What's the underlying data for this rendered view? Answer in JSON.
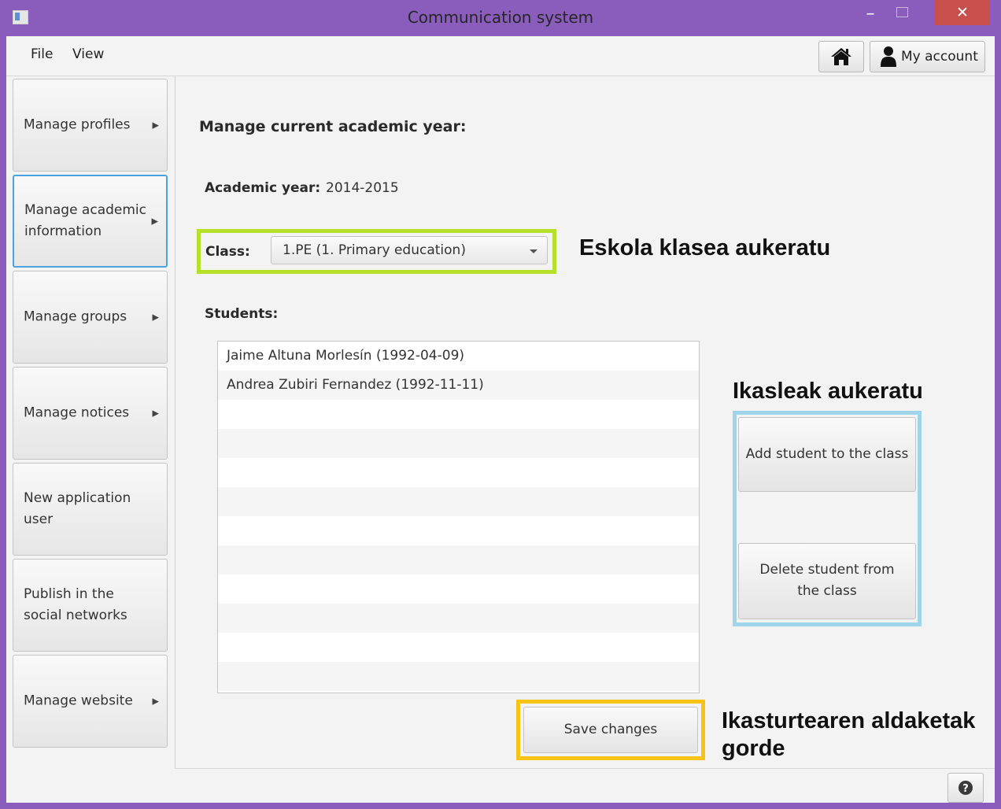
{
  "window": {
    "title": "Communication system",
    "minimize_glyph": "–",
    "close_glyph": "✕"
  },
  "menu": [
    "File",
    "View"
  ],
  "toolbar": {
    "home_icon": "home-icon",
    "account_label": "My account"
  },
  "sidebar": {
    "items": [
      {
        "label": "Manage profiles",
        "has_arrow": true
      },
      {
        "label": "Manage academic information",
        "has_arrow": true,
        "active": true
      },
      {
        "label": "Manage groups",
        "has_arrow": true
      },
      {
        "label": "Manage notices",
        "has_arrow": true
      },
      {
        "label": "New application user",
        "has_arrow": false
      },
      {
        "label": "Publish in the social networks",
        "has_arrow": false
      },
      {
        "label": "Manage website",
        "has_arrow": true
      }
    ]
  },
  "main": {
    "title": "Manage current academic year:",
    "academic_year_label": "Academic year:",
    "academic_year_value": "2014-2015",
    "class_label": "Class:",
    "class_selected": "1.PE (1. Primary education)",
    "students_label": "Students:",
    "students": [
      "Jaime Altuna Morlesín (1992-04-09)",
      "Andrea Zubiri Fernandez (1992-11-11)"
    ],
    "add_student_label": "Add student to the class",
    "delete_student_label": "Delete student from the class",
    "save_label": "Save changes"
  },
  "annotations": {
    "class_note": "Eskola klasea aukeratu",
    "students_note": "Ikasleak aukeratu",
    "save_note_line1": "Ikasturtearen aldaketak",
    "save_note_line2": "gorde"
  },
  "colors": {
    "window_frame": "#8a5cbc",
    "close_button": "#c7504d",
    "highlight_class": "#b7e02a",
    "highlight_students": "#9fd4ea",
    "highlight_save": "#f7c315",
    "active_border": "#4aa3e0"
  }
}
